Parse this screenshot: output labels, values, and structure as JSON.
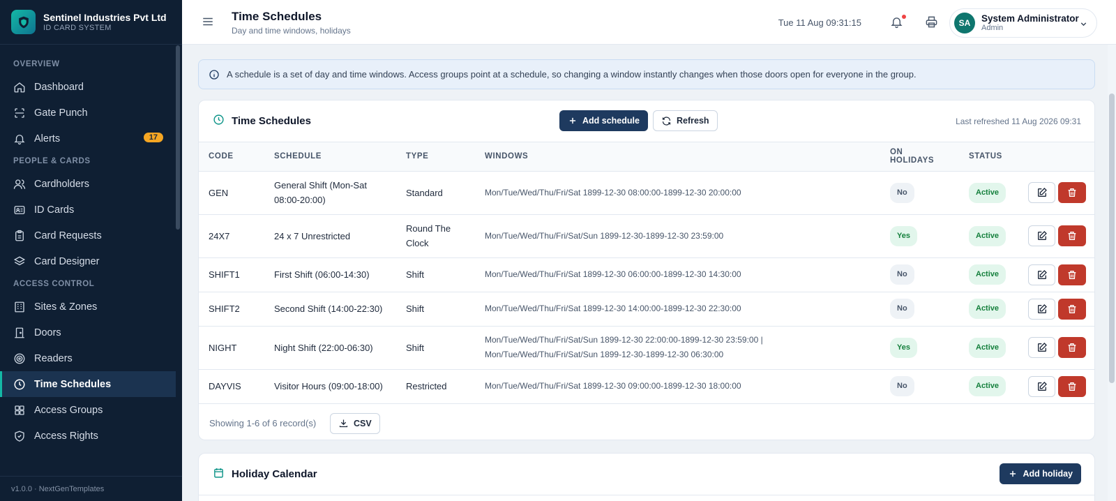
{
  "brand": {
    "name": "Sentinel Industries Pvt Ltd",
    "sub": "ID CARD SYSTEM",
    "footer": "v1.0.0 · NextGenTemplates"
  },
  "nav": {
    "sections": [
      {
        "title": "OVERVIEW",
        "items": [
          {
            "label": "Dashboard",
            "icon": "home-icon"
          },
          {
            "label": "Gate Punch",
            "icon": "scan-icon"
          },
          {
            "label": "Alerts",
            "icon": "bell-icon",
            "badge": "17"
          }
        ]
      },
      {
        "title": "PEOPLE & CARDS",
        "items": [
          {
            "label": "Cardholders",
            "icon": "users-icon"
          },
          {
            "label": "ID Cards",
            "icon": "id-card-icon"
          },
          {
            "label": "Card Requests",
            "icon": "clipboard-icon"
          },
          {
            "label": "Card Designer",
            "icon": "layers-icon"
          }
        ]
      },
      {
        "title": "ACCESS CONTROL",
        "items": [
          {
            "label": "Sites & Zones",
            "icon": "building-icon"
          },
          {
            "label": "Doors",
            "icon": "door-icon"
          },
          {
            "label": "Readers",
            "icon": "target-icon"
          },
          {
            "label": "Time Schedules",
            "icon": "clock-icon",
            "active": true
          },
          {
            "label": "Access Groups",
            "icon": "grid-icon"
          },
          {
            "label": "Access Rights",
            "icon": "shield-icon"
          }
        ]
      }
    ]
  },
  "header": {
    "title": "Time Schedules",
    "subtitle": "Day and time windows, holidays",
    "datetime": "Tue 11 Aug 09:31:15",
    "user": {
      "initials": "SA",
      "name": "System Administrator",
      "role": "Admin"
    }
  },
  "info": "A schedule is a set of day and time windows. Access groups point at a schedule, so changing a window instantly changes when those doors open for everyone in the group.",
  "schedules_card": {
    "title": "Time Schedules",
    "add_label": "Add schedule",
    "refresh_label": "Refresh",
    "last_refreshed": "Last refreshed 11 Aug 2026 09:31",
    "columns": [
      "CODE",
      "SCHEDULE",
      "TYPE",
      "WINDOWS",
      "ON HOLIDAYS",
      "STATUS",
      ""
    ],
    "rows": [
      {
        "code": "GEN",
        "schedule": "General Shift (Mon-Sat 08:00-20:00)",
        "type": "Standard",
        "windows": "Mon/Tue/Wed/Thu/Fri/Sat 1899-12-30 08:00:00-1899-12-30 20:00:00",
        "holidays": "No",
        "status": "Active"
      },
      {
        "code": "24X7",
        "schedule": "24 x 7 Unrestricted",
        "type": "Round The Clock",
        "windows": "Mon/Tue/Wed/Thu/Fri/Sat/Sun 1899-12-30-1899-12-30 23:59:00",
        "holidays": "Yes",
        "status": "Active"
      },
      {
        "code": "SHIFT1",
        "schedule": "First Shift (06:00-14:30)",
        "type": "Shift",
        "windows": "Mon/Tue/Wed/Thu/Fri/Sat 1899-12-30 06:00:00-1899-12-30 14:30:00",
        "holidays": "No",
        "status": "Active"
      },
      {
        "code": "SHIFT2",
        "schedule": "Second Shift (14:00-22:30)",
        "type": "Shift",
        "windows": "Mon/Tue/Wed/Thu/Fri/Sat 1899-12-30 14:00:00-1899-12-30 22:30:00",
        "holidays": "No",
        "status": "Active"
      },
      {
        "code": "NIGHT",
        "schedule": "Night Shift (22:00-06:30)",
        "type": "Shift",
        "windows": "Mon/Tue/Wed/Thu/Fri/Sat/Sun 1899-12-30 22:00:00-1899-12-30 23:59:00 | Mon/Tue/Wed/Thu/Fri/Sat/Sun 1899-12-30-1899-12-30 06:30:00",
        "holidays": "Yes",
        "status": "Active"
      },
      {
        "code": "DAYVIS",
        "schedule": "Visitor Hours (09:00-18:00)",
        "type": "Restricted",
        "windows": "Mon/Tue/Wed/Thu/Fri/Sat 1899-12-30 09:00:00-1899-12-30 18:00:00",
        "holidays": "No",
        "status": "Active"
      }
    ],
    "showing": "Showing 1-6 of 6 record(s)",
    "csv_label": "CSV"
  },
  "holiday_card": {
    "title": "Holiday Calendar",
    "add_label": "Add holiday"
  },
  "colors": {
    "sidebar": "#0f1f33",
    "accent": "#14b8a6",
    "primary": "#1e3a5f",
    "danger": "#c0392b",
    "success": "#15803d"
  }
}
